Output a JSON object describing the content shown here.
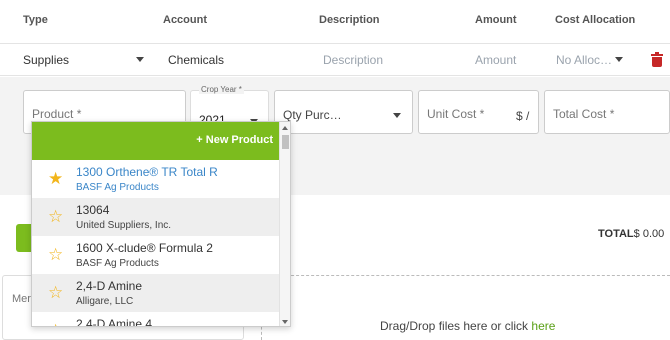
{
  "header": {
    "type": "Type",
    "account": "Account",
    "description": "Description",
    "amount": "Amount",
    "cost_allocation": "Cost Allocation"
  },
  "line": {
    "type": "Supplies",
    "account": "Chemicals",
    "description_placeholder": "Description",
    "amount_placeholder": "Amount",
    "allocation_placeholder": "No Alloc…"
  },
  "panel": {
    "product_placeholder": "Product *",
    "crop_year_label": "Crop Year *",
    "crop_year_value": "2021",
    "qty_placeholder": "Qty Purc…",
    "unit_cost_placeholder": "Unit Cost *",
    "unit_suffix": "$ /",
    "total_cost_placeholder": "Total Cost *"
  },
  "dropdown": {
    "new_product": "+ New Product",
    "items": [
      {
        "name": "1300 Orthene® TR Total R",
        "supplier": "BASF Ag Products",
        "favorite": true
      },
      {
        "name": "13064",
        "supplier": "United Suppliers, Inc.",
        "favorite": false
      },
      {
        "name": "1600 X-clude® Formula 2",
        "supplier": "BASF Ag Products",
        "favorite": false
      },
      {
        "name": "2,4-D Amine",
        "supplier": "Alligare, LLC",
        "favorite": false
      },
      {
        "name": "2,4-D Amine 4",
        "supplier": "",
        "favorite": false
      }
    ]
  },
  "footer": {
    "total_label": "TOTAL",
    "total_value": "$ 0.00",
    "memo_partial": "Mer",
    "drop_text": "Drag/Drop files here or click ",
    "drop_link": "here"
  },
  "colors": {
    "accent_green": "#7cbc1e",
    "link_blue": "#3a86c8",
    "star_gold": "#f2b51b",
    "danger_red": "#c62828"
  }
}
